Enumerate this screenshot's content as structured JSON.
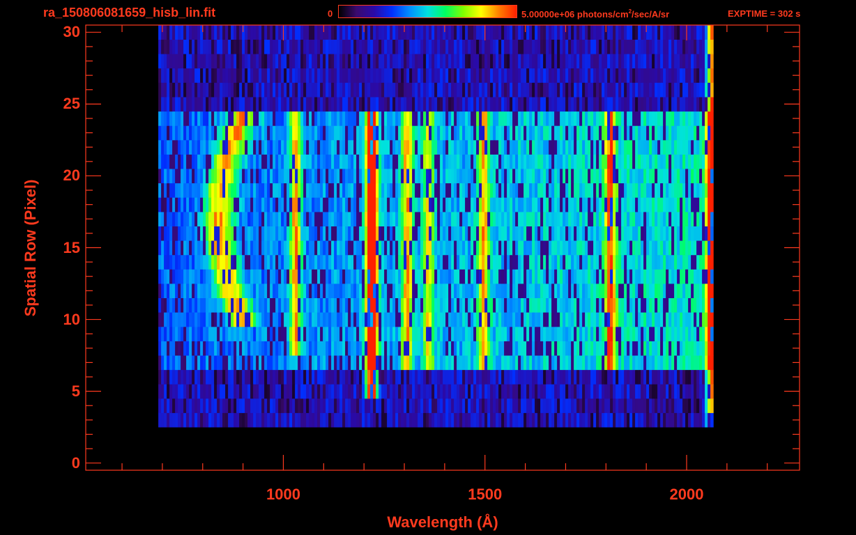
{
  "header": {
    "file_title": "ra_150806081659_hisb_lin.fit",
    "colorbar_min": "0",
    "colorbar_max_prefix": "5.00000e+06 photons/cm",
    "colorbar_max_exp": "2",
    "colorbar_max_suffix": "/sec/A/sr",
    "exptime": "EXPTIME = 302 s"
  },
  "colors": {
    "axis": "#ff3a1e",
    "background": "#000000",
    "colormap": [
      "#000000",
      "#3a0a6e",
      "#2a0aa8",
      "#0030ff",
      "#0090ff",
      "#00e0e0",
      "#00ff60",
      "#80ff00",
      "#ffff00",
      "#ff8000",
      "#ff2000"
    ]
  },
  "chart_data": {
    "type": "heatmap",
    "title": "ra_150806081659_hisb_lin.fit",
    "xlabel": "Wavelength (Å)",
    "ylabel": "Spatial Row (Pixel)",
    "xlim": [
      510,
      2280
    ],
    "ylim": [
      -0.5,
      30.5
    ],
    "xticks": [
      1000,
      1500,
      2000
    ],
    "yticks": [
      0,
      5,
      10,
      15,
      20,
      25,
      30
    ],
    "colorbar_range": [
      0,
      5000000
    ],
    "colorbar_units": "photons/cm^2/sec/A/sr",
    "data_extent_x": [
      690,
      2065
    ],
    "data_extent_y": [
      3,
      30
    ],
    "features": [
      {
        "type": "emission_line",
        "wavelength": 1216,
        "rows": [
          5,
          24
        ],
        "peak_intensity": 1.0
      },
      {
        "type": "emission_line",
        "wavelength": 1027,
        "rows": [
          8,
          24
        ],
        "peak_intensity": 0.5
      },
      {
        "type": "emission_line",
        "wavelength": 1304,
        "rows": [
          7,
          24
        ],
        "peak_intensity": 0.45
      },
      {
        "type": "emission_line",
        "wavelength": 1356,
        "rows": [
          7,
          24
        ],
        "peak_intensity": 0.35
      },
      {
        "type": "emission_line",
        "wavelength": 1493,
        "rows": [
          7,
          24
        ],
        "peak_intensity": 0.42
      },
      {
        "type": "emission_line",
        "wavelength": 1808,
        "rows": [
          7,
          24
        ],
        "peak_intensity": 0.48
      },
      {
        "type": "emission_line",
        "wavelength": 2060,
        "rows": [
          1,
          30
        ],
        "peak_intensity": 0.7
      },
      {
        "type": "arc_band",
        "wavelength_range": [
          800,
          920
        ],
        "rows": [
          10,
          24
        ],
        "peak_intensity": 0.5
      }
    ]
  }
}
